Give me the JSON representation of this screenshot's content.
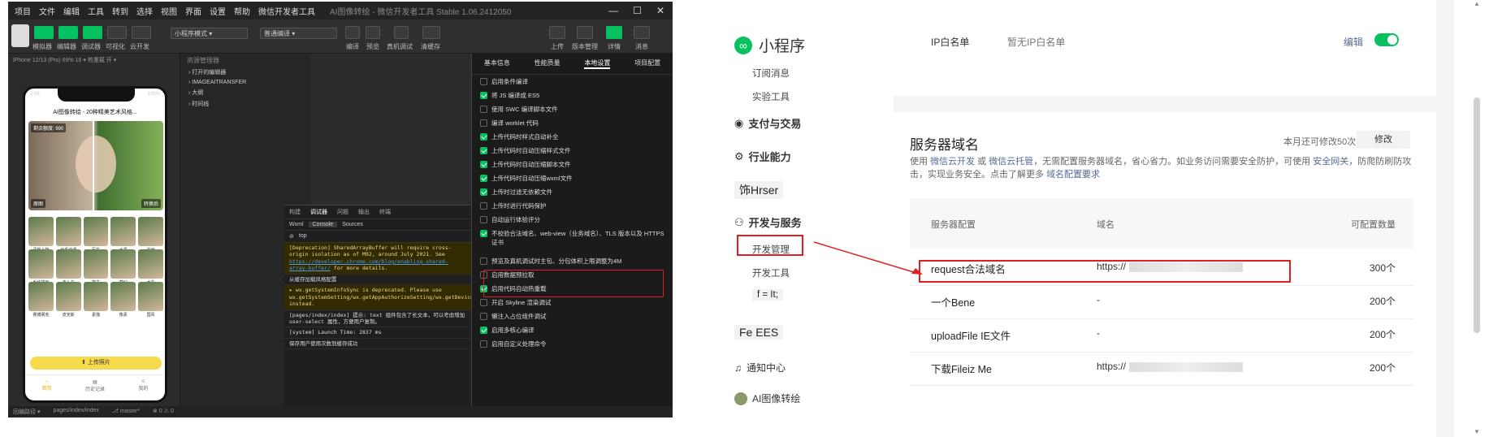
{
  "ide": {
    "menu": [
      "项目",
      "文件",
      "编辑",
      "工具",
      "转到",
      "选择",
      "视图",
      "界面",
      "设置",
      "帮助",
      "微信开发者工具"
    ],
    "window_title": "AI图像转绘 - 微信开发者工具 Stable 1.06.2412050",
    "win_controls": [
      "—",
      "☐",
      "✕"
    ],
    "toolbar": {
      "left_labels": [
        "模拟器",
        "编辑器",
        "调试器",
        "可视化",
        "云开发"
      ],
      "mode_select": "小程序模式",
      "compile_select": "普通编译",
      "mid_labels": [
        "编译",
        "预览",
        "真机调试",
        "清缓存"
      ],
      "right_labels": [
        "上传",
        "版本管理",
        "详情",
        "消息"
      ]
    },
    "device_bar": "iPhone 12/13 (Pro) 69% 16 ▾   热重载 开 ▾",
    "phone": {
      "time": "2:06",
      "battery": "100%",
      "nav_title": "AI图像转绘 - 20种精美艺术风格...",
      "hero_tag": "剩余额度: 990",
      "hero_before": "原图",
      "hero_after": "转换后",
      "styles": [
        "清新人物",
        "日系动漫",
        "写实",
        "水墨",
        "油画",
        "手绘插画",
        "吉卜力",
        "复古",
        "梦幻",
        "水彩",
        "赛博朋克",
        "皮克斯",
        "素描",
        "像素",
        "国风"
      ],
      "upload_label": "上传照片",
      "tabs": [
        "首页",
        "历史记录",
        "我的"
      ]
    },
    "explorer": {
      "header": "资源管理器",
      "rows": [
        "› 打开的编辑器",
        "› IMAGEAITRANSFER",
        "› 大纲",
        "› 时间线"
      ]
    },
    "debug": {
      "tabs": [
        "构建",
        "调试器",
        "问题",
        "输出",
        "终端"
      ],
      "subtabs": [
        "Wxml",
        "Console",
        "Sources"
      ],
      "filter": "top",
      "lines": [
        {
          "warn": true,
          "text": "[Deprecation] SharedArrayBuffer will require cross-origin isolation as of M92, around July 2021. See ",
          "link": "https://developer.chrome.com/blog/enabling-shared-array-buffer/",
          "tail": " for more details."
        },
        {
          "warn": false,
          "text": "从缓存加载风格配置"
        },
        {
          "warn": true,
          "text": "▸ wx.getSystemInfoSync is deprecated. Please use wx.getSystemSetting/wx.getAppAuthorizeSetting/wx.getDeviceInfo/wx.getWindowInfo/wx.getAppBaseInfo instead."
        },
        {
          "warn": false,
          "text": "[pages/index/index] 提示: text 组件包含了长文本，可以考虑增加 user-select 属性，方便用户复制。"
        },
        {
          "warn": false,
          "text": "[system] Launch Time: 2837 ms"
        },
        {
          "warn": false,
          "text": "保存用户使用次数到缓存成功"
        }
      ]
    },
    "settings": {
      "tabs": [
        "基本信息",
        "性能质量",
        "本地设置",
        "项目配置"
      ],
      "active_tab": "本地设置",
      "options": [
        {
          "label": "启用条件编译",
          "on": false
        },
        {
          "label": "将 JS 编译成 ES5",
          "on": true
        },
        {
          "label": "使用 SWC 编译脚本文件",
          "on": false
        },
        {
          "label": "编译 worklet 代码",
          "on": false
        },
        {
          "label": "上传代码时样式自动补全",
          "on": true
        },
        {
          "label": "上传代码时自动压缩样式文件",
          "on": true
        },
        {
          "label": "上传代码时自动压缩脚本文件",
          "on": true
        },
        {
          "label": "上传代码时自动压缩wxml文件",
          "on": true
        },
        {
          "label": "上传时过滤无依赖文件",
          "on": true
        },
        {
          "label": "上传时进行代码保护",
          "on": false
        },
        {
          "label": "自动运行体验评分",
          "on": false
        },
        {
          "label": "不校验合法域名、web-view（业务域名）、TLS 版本以及 HTTPS 证书",
          "on": true
        },
        {
          "label": "预览及真机调试时主包、分包体积上限调整为4M",
          "on": false
        },
        {
          "label": "启用数据预拉取",
          "on": false
        },
        {
          "label": "启用代码自动热重载",
          "on": true
        },
        {
          "label": "开启 Skyline 渲染调试",
          "on": false
        },
        {
          "label": "懒注入占位组件调试",
          "on": false
        },
        {
          "label": "启用多核心编译",
          "on": true
        },
        {
          "label": "启用自定义处理命令",
          "on": false
        }
      ]
    },
    "status": [
      "回编路径 ▾",
      "pages/index/index",
      "⎇ master*",
      "⊗ 0 ⚠ 0"
    ]
  },
  "mp": {
    "brand": "小程序",
    "sidebar": {
      "sub_top": [
        "订阅消息",
        "实验工具"
      ],
      "items": [
        {
          "icon": "◉",
          "label": "支付与交易",
          "bold": true
        },
        {
          "icon": "⚙",
          "label": "行业能力",
          "bold": true
        },
        {
          "icon": "",
          "label": "饰Hrser",
          "bold": false
        },
        {
          "icon": "⚇",
          "label": "开发与服务",
          "bold": true,
          "open": true
        },
        {
          "icon": "",
          "label": "Fe EES",
          "bold": false
        },
        {
          "icon": "♫",
          "label": "通知中心",
          "bold": false
        },
        {
          "icon": "●",
          "label": "AI图像转绘",
          "bold": false
        }
      ],
      "dev_sub": [
        "开发管理",
        "开发工具",
        "f = It;"
      ]
    },
    "ip": {
      "label": "IP白名单",
      "value": "暂无IP白名单",
      "action": "编辑"
    },
    "server": {
      "title": "服务器域名",
      "quota": "本月还可修改50次",
      "modify": "修改",
      "desc_parts": [
        "使用 ",
        "微信云开发",
        " 或 ",
        "微信云托管",
        "，无需配置服务器域名，省心省力。如业务访问需要安全防护，可使用 ",
        "安全网关",
        "，防爬防刷防攻击，实现业务安全。点击了解更多 ",
        "域名配置要求"
      ],
      "columns": [
        "服务器配置",
        "域名",
        "可配置数量"
      ],
      "rows": [
        {
          "name": "request合法域名",
          "domain": "https://",
          "count": "300个"
        },
        {
          "name": "一个Bene",
          "domain": "-",
          "count": "200个"
        },
        {
          "name": "uploadFile IE文件",
          "domain": "-",
          "count": "200个"
        },
        {
          "name": "下载Fileiz Me",
          "domain": "https://",
          "count": "200个"
        }
      ]
    }
  },
  "colors": {
    "accent": "#07c160",
    "highlight": "#e02020",
    "link": "#576b95"
  }
}
